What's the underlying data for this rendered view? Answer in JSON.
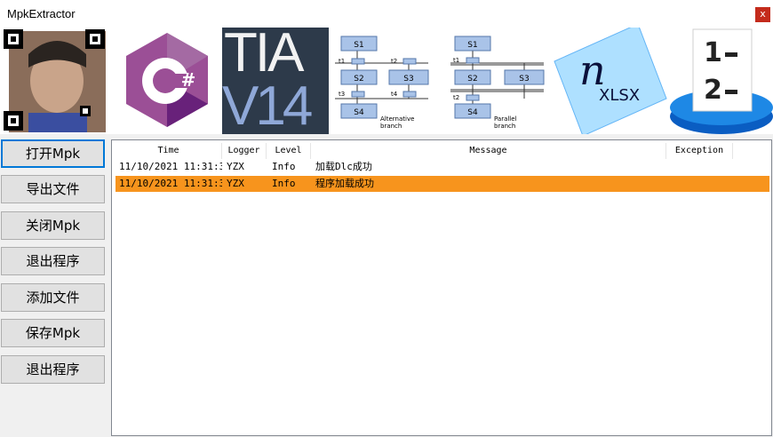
{
  "window": {
    "title": "MpkExtractor",
    "close_label": "x"
  },
  "banner": {
    "csharp_glyph": "C#",
    "tia_line1": "TIA",
    "tia_line2": "V14",
    "sfc_steps": [
      "S1",
      "S2",
      "S3",
      "S4"
    ],
    "sfc_transitions": [
      "t1",
      "t2",
      "t3",
      "t4"
    ],
    "alt_caption": "Alternative\nbranch",
    "par_caption": "Parallel\nbranch",
    "nxlsx_n": "n",
    "nxlsx_text": "XLSX",
    "list_glyph_1": "1",
    "list_glyph_2": "2"
  },
  "buttons": [
    {
      "label": "打开Mpk",
      "active": true
    },
    {
      "label": "导出文件",
      "active": false
    },
    {
      "label": "关闭Mpk",
      "active": false
    },
    {
      "label": "退出程序",
      "active": false
    },
    {
      "label": "添加文件",
      "active": false
    },
    {
      "label": "保存Mpk",
      "active": false
    },
    {
      "label": "退出程序",
      "active": false
    }
  ],
  "log_grid": {
    "columns": [
      "Time",
      "Logger",
      "Level",
      "Message",
      "Exception"
    ],
    "rows": [
      {
        "time": "11/10/2021 11:31:3",
        "logger": "YZX",
        "level": "Info",
        "message": "加载Dlc成功",
        "exception": "",
        "selected": false
      },
      {
        "time": "11/10/2021 11:31:3",
        "logger": "YZX",
        "level": "Info",
        "message": "程序加载成功",
        "exception": "",
        "selected": true
      }
    ]
  },
  "colors": {
    "accent": "#0078d7",
    "selected_row": "#f7941d",
    "close": "#c42b1c",
    "csharp": "#68217a",
    "tia_bg": "#2d3a4a",
    "tia_v": "#8fa8d8"
  }
}
